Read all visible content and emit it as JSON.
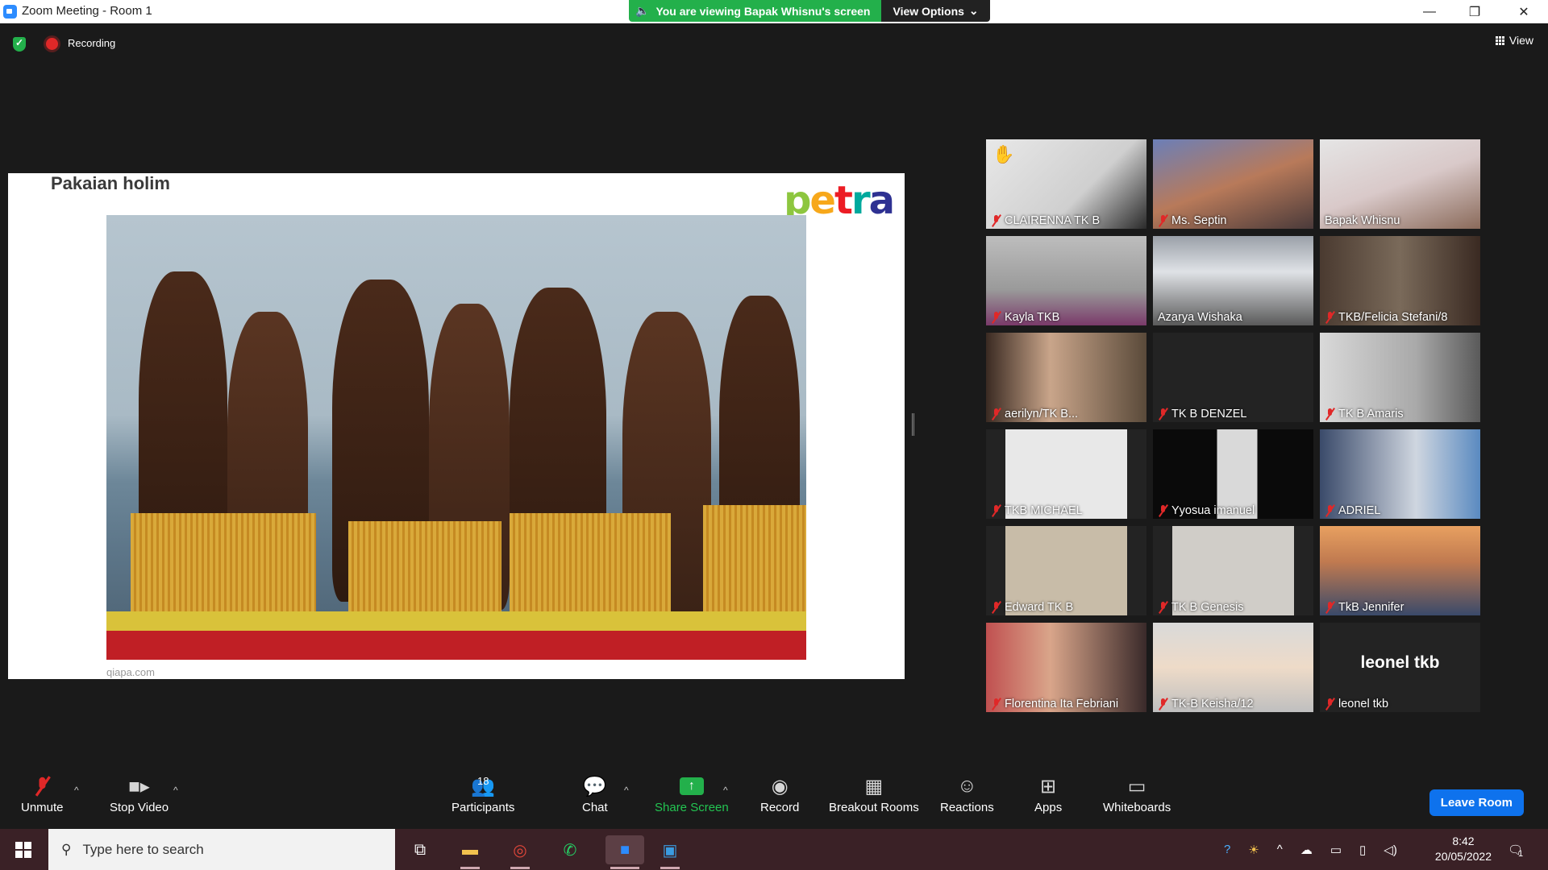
{
  "window": {
    "title": "Zoom Meeting - Room 1",
    "viewing_banner": "You are viewing Bapak Whisnu's screen",
    "view_options": "View Options"
  },
  "status": {
    "recording": "Recording",
    "view": "View"
  },
  "slide": {
    "title": "Pakaian holim",
    "logo": "petra",
    "caption": "qiapa.com"
  },
  "participants_tiles": [
    {
      "name": "CLAIRENNA TK B",
      "muted": true,
      "hand_raised": true
    },
    {
      "name": "Ms. Septin",
      "muted": true
    },
    {
      "name": "Bapak Whisnu",
      "muted": false
    },
    {
      "name": "Kayla TKB",
      "muted": true
    },
    {
      "name": "Azarya Wishaka",
      "muted": false,
      "active_speaker": true
    },
    {
      "name": "TKB/Felicia Stefani/8",
      "muted": true
    },
    {
      "name": "aerilyn/TK B...",
      "muted": true
    },
    {
      "name": "TK B DENZEL",
      "muted": true
    },
    {
      "name": "TK B Amaris",
      "muted": true
    },
    {
      "name": "TKB MICHAEL",
      "muted": true
    },
    {
      "name": "Yyosua imanuel",
      "muted": true
    },
    {
      "name": "ADRIEL",
      "muted": true
    },
    {
      "name": "Edward TK B",
      "muted": true
    },
    {
      "name": "TK B Genesis",
      "muted": true
    },
    {
      "name": "TkB Jennifer",
      "muted": true
    },
    {
      "name": "Florentina Ita Febriani",
      "muted": true
    },
    {
      "name": "TK-B Keisha/12",
      "muted": true
    },
    {
      "name": "leonel tkb",
      "muted": true,
      "big_name": "leonel tkb"
    }
  ],
  "toolbar": {
    "unmute": "Unmute",
    "stop_video": "Stop Video",
    "participants": "Participants",
    "participants_count": "18",
    "chat": "Chat",
    "share_screen": "Share Screen",
    "record": "Record",
    "breakout_rooms": "Breakout Rooms",
    "reactions": "Reactions",
    "apps": "Apps",
    "whiteboards": "Whiteboards",
    "leave_room": "Leave Room"
  },
  "taskbar": {
    "search_placeholder": "Type here to search",
    "time": "8:42",
    "date": "20/05/2022",
    "notification_count": "1"
  },
  "colors": {
    "accent_green": "#23b04b",
    "leave_blue": "#0e72ed",
    "active_speaker": "#e4d332",
    "muted_red": "#e02828"
  }
}
